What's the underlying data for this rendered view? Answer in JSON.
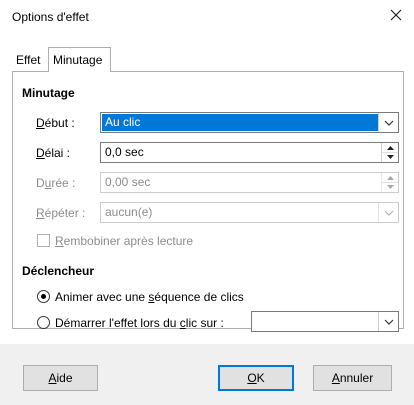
{
  "window": {
    "title": "Options d'effet",
    "close_icon": "close-icon"
  },
  "tabs": [
    {
      "label": "Effet",
      "active": false
    },
    {
      "label": "Minutage",
      "active": true
    }
  ],
  "minutage": {
    "heading": "Minutage",
    "debut": {
      "label_u": "D",
      "label_rest": "ébut :",
      "value": "Au clic"
    },
    "delai": {
      "label_u": "D",
      "label_rest": "élai :",
      "value": "0,0 sec"
    },
    "duree": {
      "label_pre": "D",
      "label_u": "u",
      "label_rest": "rée :",
      "value": "0,00 sec",
      "placeholder": "0,00 sec",
      "enabled": false
    },
    "repeter": {
      "label_u": "R",
      "label_rest": "épéter :",
      "value": "aucun(e)",
      "enabled": false
    },
    "rembobiner": {
      "label_u": "R",
      "label_rest": "embobiner après lecture",
      "checked": false,
      "enabled": false
    }
  },
  "declencheur": {
    "heading": "Déclencheur",
    "option1": {
      "label_pre": "Animer avec une ",
      "label_u": "s",
      "label_rest": "équence de clics",
      "checked": true
    },
    "option2": {
      "label_pre": "Démarrer l'effet lors du ",
      "label_u": "c",
      "label_rest": "lic sur :",
      "checked": false,
      "combo_value": ""
    }
  },
  "buttons": {
    "aide": {
      "label_u": "A",
      "label_rest": "ide"
    },
    "ok": {
      "label_u": "O",
      "label_rest": "K"
    },
    "annuler": {
      "label_u": "A",
      "label_rest": "nnuler"
    }
  },
  "colors": {
    "accent": "#0078d7",
    "footer": "#f0f0f0",
    "disabled_text": "#8c8c8c"
  }
}
